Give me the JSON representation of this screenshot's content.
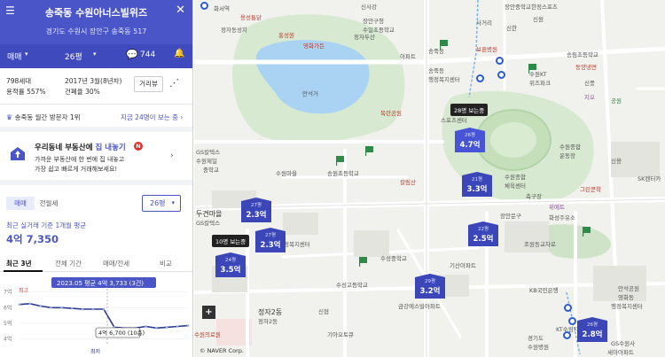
{
  "header": {
    "title": "송죽동 수원아너스빌위즈",
    "address": "경기도 수원시 장안구 송죽동 517",
    "trade_type": "매매",
    "area_type": "26평",
    "comment_count": "744"
  },
  "info": {
    "households": "798세대",
    "approval": "2017년 3월(8년차)",
    "floor_area_ratio": "용적률 557%",
    "building_coverage": "건폐율 30%",
    "distance_button": "거리뷰"
  },
  "visit": {
    "rank": "송죽동 월간 방문자 1위",
    "now_viewing": "지금 24명이 보는 중"
  },
  "promo": {
    "headline_prefix": "우리동네 부동산에 ",
    "headline_highlight": "집 내놓기",
    "new_badge": "N",
    "line1": "가까운 부동산에 한 번에 집 내놓고",
    "line2": "가장 쉽고 빠르게 거래해보세요!"
  },
  "price": {
    "tab_trade": "매매",
    "tab_jeonse": "전월세",
    "area_select": "26평",
    "recent_label": "최근 실거래 기준 1개월 평균",
    "recent_value": "4억 7,350"
  },
  "period_tabs": [
    "최근 3년",
    "전체 기간",
    "매매/전세",
    "비교"
  ],
  "chart_data": {
    "type": "line",
    "title": "",
    "yticks": [
      "7억",
      "6억",
      "5억",
      "4억"
    ],
    "ylim": [
      3.7,
      7.2
    ],
    "x": [
      0,
      1,
      2,
      3,
      4,
      5,
      6,
      7,
      8,
      9,
      10,
      11,
      12,
      13,
      14,
      15,
      16
    ],
    "values": [
      6.2,
      6.25,
      6.1,
      6.0,
      6.0,
      5.95,
      5.9,
      5.9,
      5.9,
      4.75,
      4.7,
      4.7,
      4.8,
      4.7,
      4.75,
      4.8,
      4.85
    ],
    "annotations": {
      "max_label": "최고",
      "min_label": "최저",
      "tooltip": "2023.05 평균 4억 3,733 (3건)",
      "point_label": "4억 6,700 (10층)"
    },
    "colors": {
      "line": "#2a3a8f",
      "tooltip": "#4a56c8"
    }
  },
  "map": {
    "pins": [
      {
        "size": "26평",
        "price": "4.7억"
      },
      {
        "size": "21평",
        "price": "3.3억"
      },
      {
        "size": "27평",
        "price": "2.3억"
      },
      {
        "size": "27평",
        "price": "2.3억"
      },
      {
        "size": "24평",
        "price": "3.5억"
      },
      {
        "size": "22평",
        "price": "2.5억"
      },
      {
        "size": "29평",
        "price": "3.2억"
      },
      {
        "size": "26평",
        "price": "2.8억"
      }
    ],
    "viewers": [
      "28명 보는중",
      "10명 보는중"
    ],
    "labels": [
      "화서역",
      "용성통닭",
      "정자동성지",
      "신사강",
      "장안구청",
      "수일초등학교",
      "홍성원",
      "영화가든",
      "장안중학교",
      "사거리",
      "신원",
      "신한",
      "송죽동",
      "정자두산",
      "아파트",
      "한정스포츠",
      "송죽동",
      "행정복지센터",
      "보훈병원",
      "수원KT",
      "위즈파크",
      "송림초등학교",
      "동양냉면",
      "만석거",
      "신풍",
      "지오",
      "목련공원",
      "공원",
      "스포츠센터",
      "수원종합",
      "운동장",
      "GS칼텍스",
      "수원제일",
      "중학교",
      "송원초등학교",
      "칼림산",
      "수원마을",
      "신용",
      "SK렌터카",
      "수원종합",
      "체육센터",
      "그린쿤착",
      "축구장",
      "장안문구",
      "두견마을",
      "정자2동",
      "행정복지센터",
      "GS칼텍스",
      "위에트",
      "화성주유소",
      "수성중학교",
      "조원동교차로",
      "수성고등학교",
      "기산아파트",
      "금강에스빌아파트",
      "KB국민은행",
      "경기도",
      "수원병원",
      "만석공원",
      "영화동",
      "행정복지센터",
      "정자2동",
      "신협",
      "기아오토큐",
      "KT수원지사",
      "GS수원사",
      "세아아파트",
      "수원의료원"
    ],
    "watermark": "© NAVER Corp.",
    "hospital_icon": "+"
  }
}
